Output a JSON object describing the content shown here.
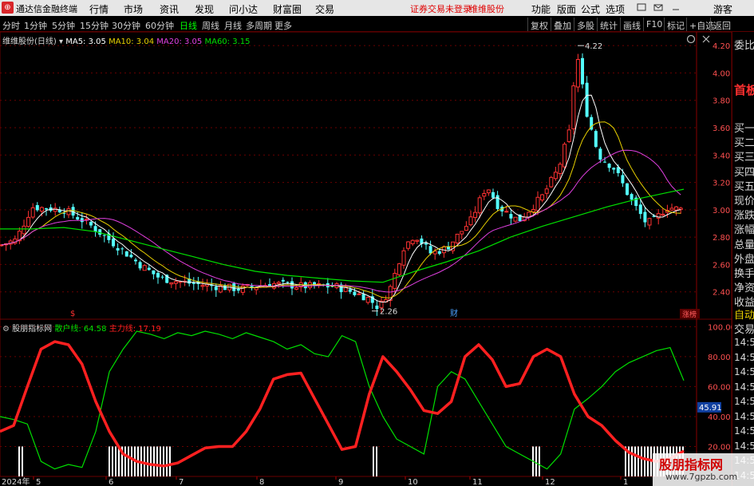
{
  "titlebar": {
    "app_name": "通达信金融终端",
    "menus": [
      "行情",
      "市场",
      "资讯",
      "发现",
      "问小达",
      "财富圈",
      "交易"
    ],
    "notice": "证券交易未登录",
    "stock_name": "维维股份",
    "right_menus": [
      "功能",
      "版面",
      "公式",
      "选项"
    ],
    "user": "游客"
  },
  "toolbar": {
    "periods": [
      "分时",
      "1分钟",
      "5分钟",
      "15分钟",
      "30分钟",
      "60分钟",
      "日线",
      "周线",
      "月线",
      "多周期",
      "更多"
    ],
    "active_period": "日线",
    "buttons": [
      "复权",
      "叠加",
      "多股",
      "统计",
      "画线",
      "F10",
      "标记",
      "+自选",
      "返回"
    ]
  },
  "main_chart": {
    "title": "维维股份(日线)",
    "ma_labels": [
      {
        "label": "MA5: 3.05",
        "color": "#ffffff"
      },
      {
        "label": "MA10: 3.04",
        "color": "#e8d000"
      },
      {
        "label": "MA20: 3.05",
        "color": "#e040e0"
      },
      {
        "label": "MA60: 3.15",
        "color": "#00e000"
      }
    ],
    "price_ticks": [
      "4.20",
      "4.00",
      "3.80",
      "3.60",
      "3.40",
      "3.20",
      "3.00",
      "2.80",
      "2.60",
      "2.40"
    ],
    "high_marker": "4.22",
    "low_marker": "2.26",
    "mark_s": "$",
    "mark_cai": "财",
    "tag": "涨榜"
  },
  "indicator": {
    "name": "股朋指标网",
    "retail_label": "散户线: 64.58",
    "main_label": "主力线: 17.19",
    "y_ticks": [
      "100.00",
      "80.00",
      "60.00",
      "40.00",
      "20.00"
    ],
    "current_value": "45.91",
    "x_year": "2024年",
    "x_months": [
      "5",
      "6",
      "7",
      "8",
      "9",
      "10",
      "11",
      "12",
      "1"
    ]
  },
  "side_panel": {
    "top": "委比",
    "header": "首板",
    "rows": [
      "买一",
      "买二",
      "买三",
      "买四",
      "买五",
      "现价",
      "涨跌",
      "涨幅",
      "总量",
      "外盘",
      "换手",
      "净资",
      "收益"
    ],
    "bottom_top": [
      "自动",
      "交易"
    ],
    "times": [
      "14:56",
      "14:56",
      "14:56",
      "14:56",
      "14:56",
      "14:56",
      "14:56",
      "14:56",
      "14:56",
      "14:56"
    ]
  },
  "watermark": {
    "line1": "股朋指标网",
    "line2": "www.7gpzb.com"
  },
  "colors": {
    "up": "#ff3232",
    "down": "#54ffff",
    "ma5": "#ffffff",
    "ma10": "#e8d000",
    "ma20": "#e040e0",
    "ma60": "#00e000",
    "retail_line": "#00e000",
    "main_line": "#ff2020",
    "grid": "#6a0000"
  },
  "chart_data": [
    {
      "type": "line",
      "title": "维维股份(日线)",
      "series": [
        {
          "name": "MA60",
          "x": [
            0,
            40,
            80,
            120,
            160,
            200,
            240,
            280,
            320,
            360,
            400,
            440,
            480,
            520,
            560,
            600,
            640,
            680,
            720,
            760,
            800,
            840,
            857
          ],
          "values": [
            2.86,
            2.86,
            2.87,
            2.84,
            2.78,
            2.72,
            2.66,
            2.6,
            2.55,
            2.52,
            2.5,
            2.48,
            2.47,
            2.55,
            2.62,
            2.7,
            2.8,
            2.88,
            2.95,
            3.02,
            3.08,
            3.13,
            3.15
          ]
        }
      ],
      "ylim": [
        2.2,
        4.3
      ],
      "yticks": [
        2.4,
        2.6,
        2.8,
        3.0,
        3.2,
        3.4,
        3.6,
        3.8,
        4.0,
        4.2
      ]
    },
    {
      "type": "line",
      "title": "股朋指标网",
      "series": [
        {
          "name": "散户线",
          "values": [
            40,
            38,
            35,
            10,
            5,
            8,
            6,
            30,
            70,
            85,
            97,
            95,
            92,
            96,
            94,
            97,
            95,
            92,
            96,
            93,
            90,
            85,
            88,
            82,
            80,
            94,
            90,
            60,
            40,
            25,
            20,
            15,
            60,
            70,
            65,
            50,
            35,
            20,
            15,
            10,
            5,
            15,
            45,
            52,
            60,
            70,
            76,
            80,
            84,
            86,
            64
          ]
        },
        {
          "name": "主力线",
          "values": [
            30,
            34,
            60,
            85,
            90,
            88,
            75,
            50,
            30,
            15,
            10,
            8,
            7,
            9,
            14,
            19,
            20,
            20,
            30,
            45,
            65,
            68,
            69,
            52,
            35,
            18,
            20,
            55,
            80,
            70,
            58,
            44,
            42,
            50,
            80,
            88,
            78,
            60,
            62,
            80,
            85,
            80,
            55,
            40,
            34,
            24,
            16,
            12,
            10,
            12,
            17
          ]
        }
      ],
      "ylim": [
        0,
        105
      ],
      "yticks": [
        20,
        40,
        60,
        80,
        100
      ]
    }
  ]
}
